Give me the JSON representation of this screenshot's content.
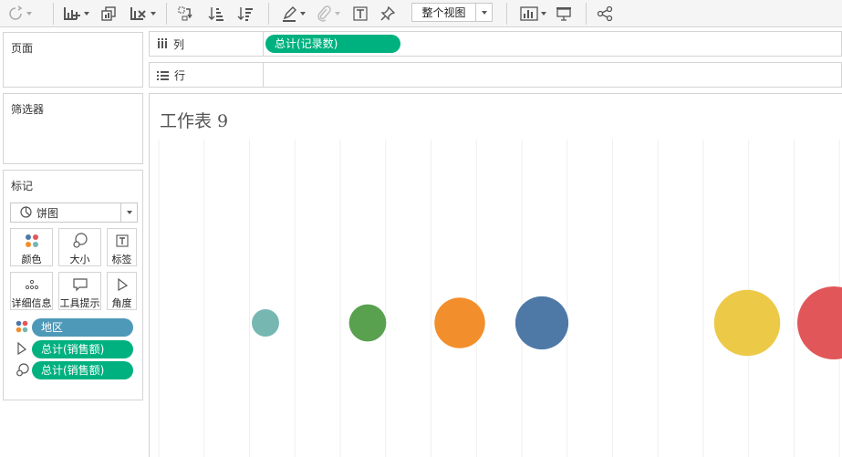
{
  "toolbar": {
    "fit_label": "整个视图",
    "icons": [
      "redo-icon",
      "new-worksheet-icon",
      "duplicate-icon",
      "clear-sheet-icon",
      "swap-icon",
      "sort-ascending-icon",
      "sort-descending-icon",
      "highlight-icon",
      "paperclip-icon",
      "text-label-icon",
      "pin-icon",
      "show-me-icon",
      "presentation-icon",
      "share-icon"
    ]
  },
  "panels": {
    "pages": "页面",
    "filters": "筛选器",
    "marks": "标记"
  },
  "marks": {
    "type": "饼图",
    "buttons": [
      {
        "label": "颜色",
        "icon": "color-dots-icon"
      },
      {
        "label": "大小",
        "icon": "size-icon"
      },
      {
        "label": "标签",
        "icon": "label-icon"
      },
      {
        "label": "详细信息",
        "icon": "detail-icon"
      },
      {
        "label": "工具提示",
        "icon": "tooltip-icon"
      },
      {
        "label": "角度",
        "icon": "angle-icon"
      }
    ],
    "pills": [
      {
        "label": "地区",
        "icon": "color-dots-icon",
        "color": "#4e98b8"
      },
      {
        "label": "总计(销售额)",
        "icon": "angle-icon",
        "color": "#00b180"
      },
      {
        "label": "总计(销售额)",
        "icon": "size-icon",
        "color": "#00b180"
      }
    ]
  },
  "shelves": {
    "columns_label": "列",
    "rows_label": "行",
    "columns_pill": "总计(记录数)",
    "pill_color": "#00b180"
  },
  "worksheet": {
    "title": "工作表 9"
  },
  "chart_data": {
    "type": "scatter",
    "mark": "pie",
    "points": [
      {
        "x": 1.17,
        "size": 14,
        "color": "#76b7b2"
      },
      {
        "x": 2.29,
        "size": 26,
        "color": "#59a14f"
      },
      {
        "x": 3.3,
        "size": 48,
        "color": "#f28e2b"
      },
      {
        "x": 4.2,
        "size": 53,
        "color": "#4e79a7"
      },
      {
        "x": 6.45,
        "size": 82,
        "color": "#edc948"
      },
      {
        "x": 7.4,
        "size": 100,
        "color": "#e15759"
      }
    ],
    "xlim": [
      0,
      8
    ],
    "grid_lines": 16,
    "grid": true
  }
}
